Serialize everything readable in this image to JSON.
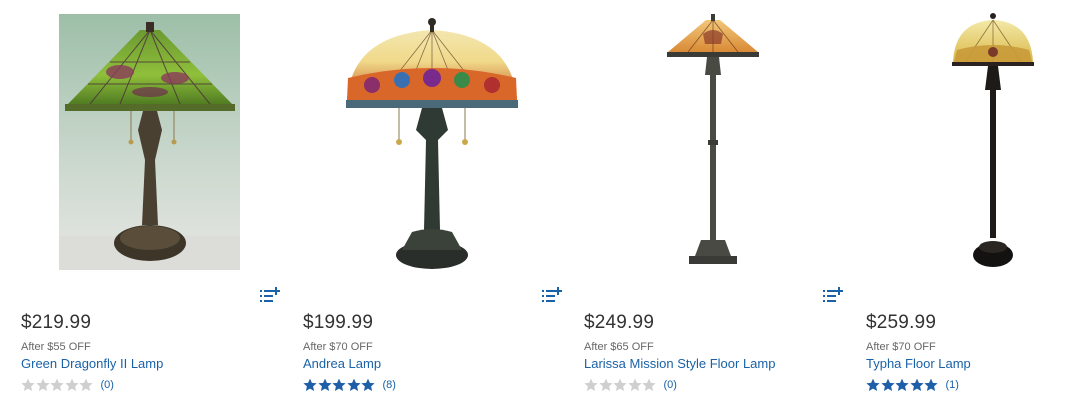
{
  "colors": {
    "link": "#1a62a8",
    "star_filled": "#1f5fa8",
    "star_empty": "#cfcfcf",
    "price": "#333333",
    "promo": "#666666"
  },
  "products": [
    {
      "price": "$219.99",
      "promo": "After $55 OFF",
      "name": "Green Dragonfly II Lamp",
      "rating": 0,
      "reviews": "(0)",
      "image_icon": "lamp-photo-icon",
      "list_icon": "add-to-list-icon"
    },
    {
      "price": "$199.99",
      "promo": "After $70 OFF",
      "name": "Andrea Lamp",
      "rating": 5,
      "reviews": "(8)",
      "image_icon": "lamp-photo-icon",
      "list_icon": "add-to-list-icon"
    },
    {
      "price": "$249.99",
      "promo": "After $65 OFF",
      "name": "Larissa Mission Style Floor Lamp",
      "rating": 0,
      "reviews": "(0)",
      "image_icon": "lamp-photo-icon",
      "list_icon": "add-to-list-icon"
    },
    {
      "price": "$259.99",
      "promo": "After $70 OFF",
      "name": "Typha Floor Lamp",
      "rating": 5,
      "reviews": "(1)",
      "image_icon": "lamp-photo-icon",
      "list_icon": "add-to-list-icon"
    }
  ]
}
